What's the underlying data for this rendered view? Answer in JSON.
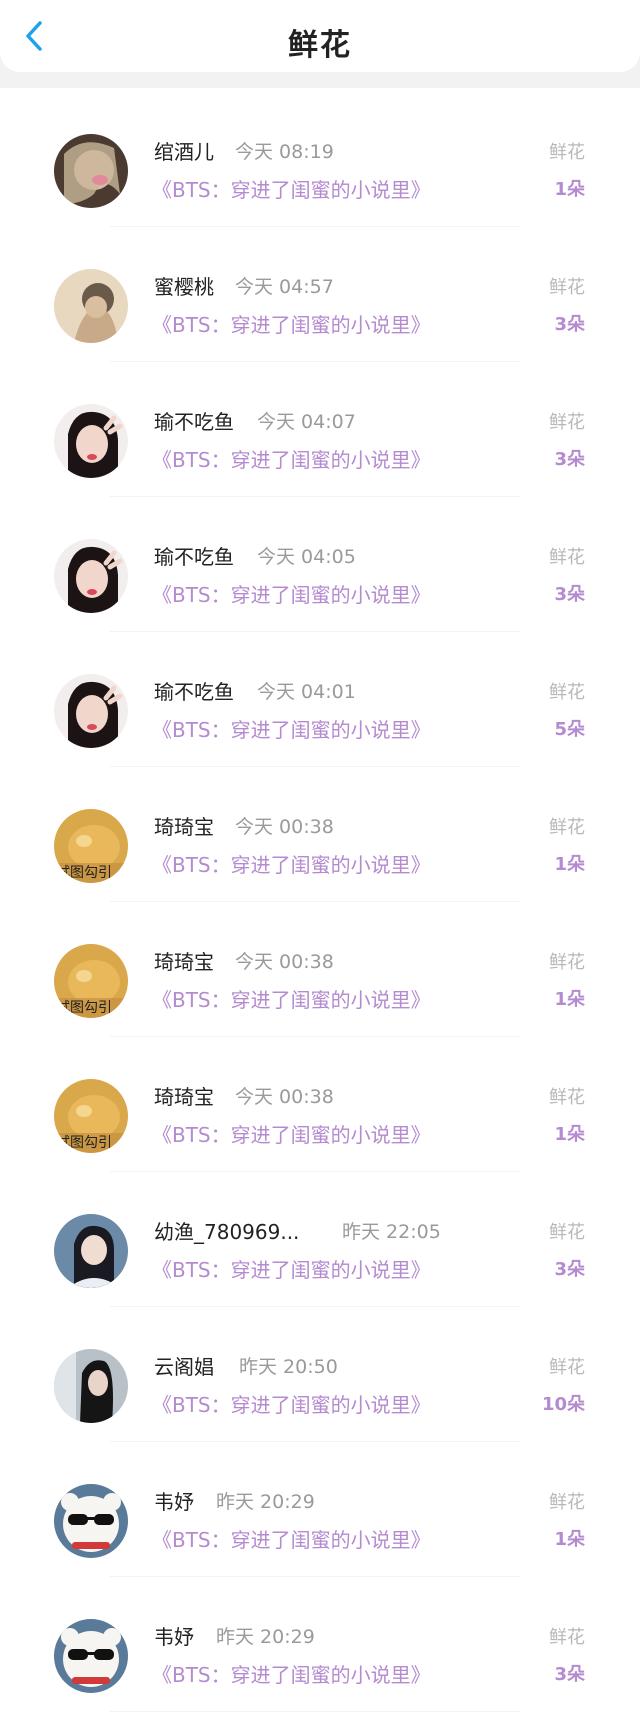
{
  "header": {
    "title": "鲜花",
    "back_icon": "chevron-left-icon"
  },
  "colors": {
    "accent_purple": "#b48ad0",
    "back_blue": "#1aa3e8",
    "muted_gray": "#9a9a9a"
  },
  "gifts": [
    {
      "name": "绾酒儿",
      "time": "今天 08:19",
      "book": "《BTS：穿进了闺蜜的小说里》",
      "label": "鲜花",
      "count": "1朵",
      "avatar": "portrait-girl-blonde"
    },
    {
      "name": "蜜樱桃",
      "time": "今天 04:57",
      "book": "《BTS：穿进了闺蜜的小说里》",
      "label": "鲜花",
      "count": "3朵",
      "avatar": "portrait-girl-sepia"
    },
    {
      "name": "瑜不吃鱼",
      "time": "今天 04:07",
      "book": "《BTS：穿进了闺蜜的小说里》",
      "label": "鲜花",
      "count": "3朵",
      "avatar": "portrait-girl-peace-sign"
    },
    {
      "name": "瑜不吃鱼",
      "time": "今天 04:05",
      "book": "《BTS：穿进了闺蜜的小说里》",
      "label": "鲜花",
      "count": "3朵",
      "avatar": "portrait-girl-peace-sign"
    },
    {
      "name": "瑜不吃鱼",
      "time": "今天 04:01",
      "book": "《BTS：穿进了闺蜜的小说里》",
      "label": "鲜花",
      "count": "5朵",
      "avatar": "portrait-girl-peace-sign"
    },
    {
      "name": "琦琦宝",
      "time": "今天 00:38",
      "book": "《BTS：穿进了闺蜜的小说里》",
      "label": "鲜花",
      "count": "1朵",
      "avatar": "shiba-dog-meme"
    },
    {
      "name": "琦琦宝",
      "time": "今天 00:38",
      "book": "《BTS：穿进了闺蜜的小说里》",
      "label": "鲜花",
      "count": "1朵",
      "avatar": "shiba-dog-meme"
    },
    {
      "name": "琦琦宝",
      "time": "今天 00:38",
      "book": "《BTS：穿进了闺蜜的小说里》",
      "label": "鲜花",
      "count": "1朵",
      "avatar": "shiba-dog-meme"
    },
    {
      "name": "幼渔_780969...",
      "time": "昨天 22:05",
      "book": "《BTS：穿进了闺蜜的小说里》",
      "label": "鲜花",
      "count": "3朵",
      "avatar": "portrait-girl-blue"
    },
    {
      "name": "云阁娼",
      "time": "昨天 20:50",
      "book": "《BTS：穿进了闺蜜的小说里》",
      "label": "鲜花",
      "count": "10朵",
      "avatar": "portrait-girl-dark"
    },
    {
      "name": "韦妤",
      "time": "昨天 20:29",
      "book": "《BTS：穿进了闺蜜的小说里》",
      "label": "鲜花",
      "count": "1朵",
      "avatar": "bear-sunglasses"
    },
    {
      "name": "韦妤",
      "time": "昨天 20:29",
      "book": "《BTS：穿进了闺蜜的小说里》",
      "label": "鲜花",
      "count": "3朵",
      "avatar": "bear-sunglasses"
    }
  ]
}
